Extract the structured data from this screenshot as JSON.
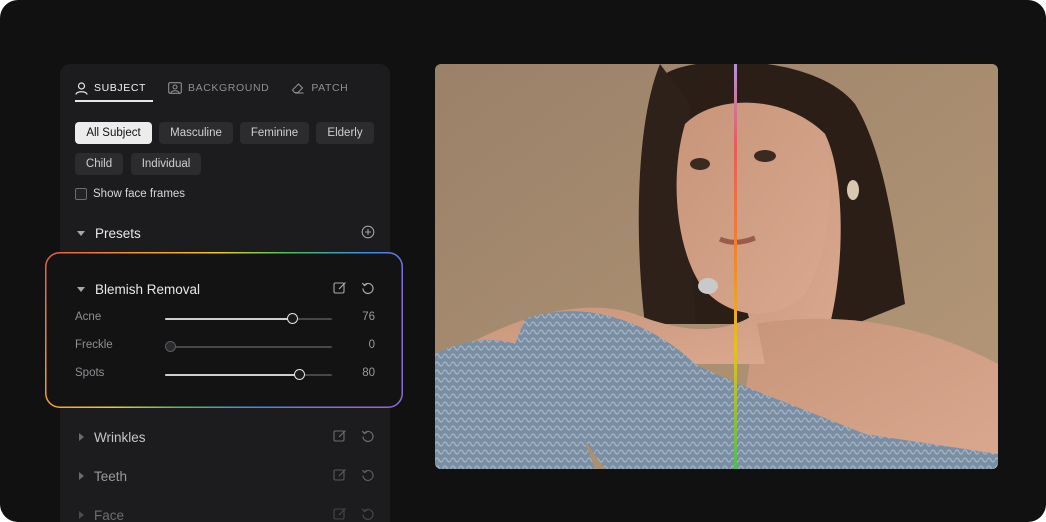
{
  "tabs": [
    {
      "label": "SUBJECT",
      "icon": "person-icon",
      "active": true
    },
    {
      "label": "BACKGROUND",
      "icon": "image-icon",
      "active": false
    },
    {
      "label": "PATCH",
      "icon": "eraser-icon",
      "active": false
    }
  ],
  "chips": [
    "All Subject",
    "Masculine",
    "Feminine",
    "Elderly",
    "Child",
    "Individual"
  ],
  "active_chip": "All Subject",
  "show_face_frames": {
    "label": "Show face frames",
    "checked": false
  },
  "presets": {
    "label": "Presets",
    "add_icon": "plus-circle-icon"
  },
  "blemish": {
    "label": "Blemish Removal",
    "sliders": [
      {
        "label": "Acne",
        "value": "76",
        "level": 0.76
      },
      {
        "label": "Freckle",
        "value": "0",
        "level": 0
      },
      {
        "label": "Spots",
        "value": "80",
        "level": 0.8
      }
    ]
  },
  "sections": [
    {
      "label": "Wrinkles"
    },
    {
      "label": "Teeth"
    },
    {
      "label": "Face"
    }
  ],
  "colors": {
    "accent_gradient": [
      "#e65a52",
      "#f39a2b",
      "#eace2a",
      "#4dbf5c",
      "#3a8de0",
      "#8c6ad8"
    ]
  }
}
